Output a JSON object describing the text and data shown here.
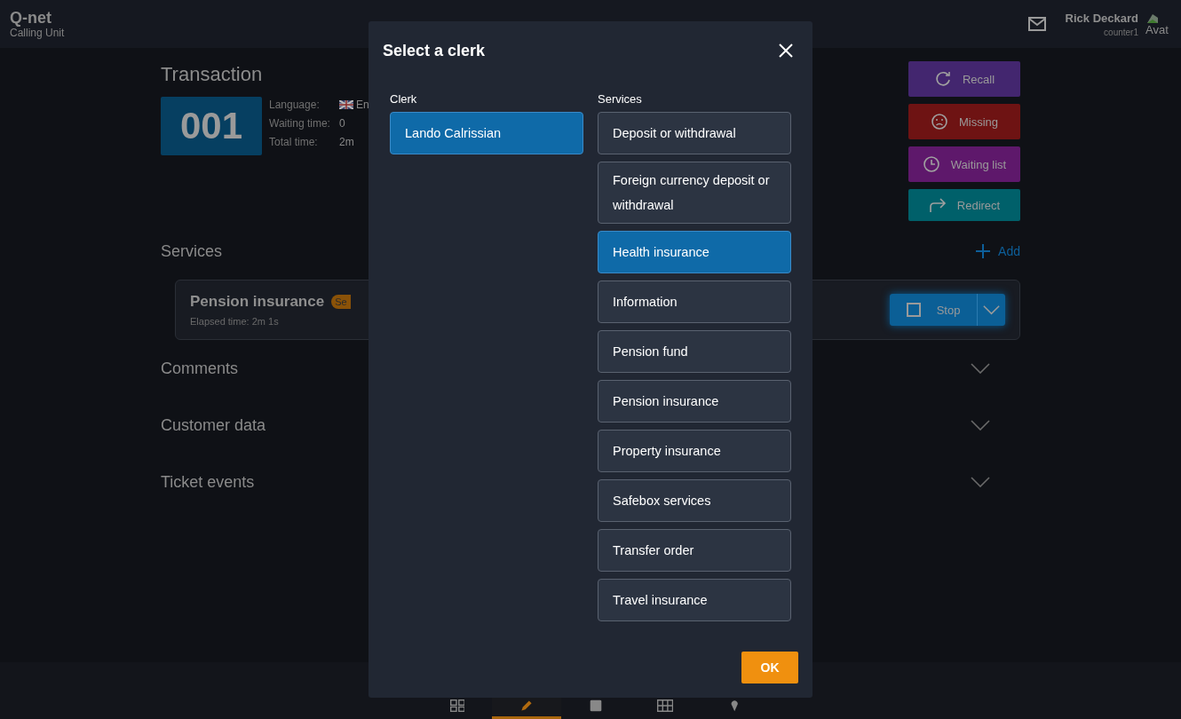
{
  "header": {
    "logo": "Q-net",
    "subtitle": "Calling Unit",
    "user_name": "Rick Deckard",
    "user_counter": "counter1",
    "avatar_text": "Avat"
  },
  "transaction": {
    "title": "Transaction",
    "ticket": "001",
    "details": [
      {
        "label": "Language:",
        "value": "En",
        "kind": "flag"
      },
      {
        "label": "Waiting time:",
        "value": "0",
        "kind": "plain"
      },
      {
        "label": "Total time:",
        "value": "2m",
        "kind": "plain"
      }
    ]
  },
  "actions": [
    {
      "label": "Recall",
      "kind": "recall",
      "color": "#43266f"
    },
    {
      "label": "Missing",
      "kind": "missing",
      "color": "#6e1313"
    },
    {
      "label": "Waiting list",
      "kind": "waiting",
      "color": "#5e186b"
    },
    {
      "label": "Redirect",
      "kind": "redirect",
      "color": "#00606a"
    }
  ],
  "services": {
    "title": "Services",
    "add_label": "Add",
    "current": {
      "name": "Pension insurance",
      "badge": "Se",
      "elapsed": "Elapsed time: 2m 1s",
      "stop_label": "Stop"
    }
  },
  "sections": [
    {
      "title": "Comments",
      "expanded": false
    },
    {
      "title": "Customer data",
      "expanded": false
    },
    {
      "title": "Ticket events",
      "expanded": false
    }
  ],
  "bottom_nav": [
    {
      "kind": "grid",
      "selected": false
    },
    {
      "kind": "pencil",
      "selected": true
    },
    {
      "kind": "tile",
      "selected": false
    },
    {
      "kind": "table",
      "selected": false
    },
    {
      "kind": "pin",
      "selected": false
    }
  ],
  "dialog": {
    "title": "Select a clerk",
    "clerk_heading": "Clerk",
    "services_heading": "Services",
    "ok_label": "OK",
    "clerks": [
      {
        "name": "Lando Calrissian",
        "selected": true
      }
    ],
    "services": [
      {
        "name": "Deposit or withdrawal",
        "selected": false
      },
      {
        "name": "Foreign currency deposit or withdrawal",
        "selected": false
      },
      {
        "name": "Health insurance",
        "selected": true
      },
      {
        "name": "Information",
        "selected": false
      },
      {
        "name": "Pension fund",
        "selected": false
      },
      {
        "name": "Pension insurance",
        "selected": false
      },
      {
        "name": "Property insurance",
        "selected": false
      },
      {
        "name": "Safebox services",
        "selected": false
      },
      {
        "name": "Transfer order",
        "selected": false
      },
      {
        "name": "Travel insurance",
        "selected": false
      }
    ]
  }
}
